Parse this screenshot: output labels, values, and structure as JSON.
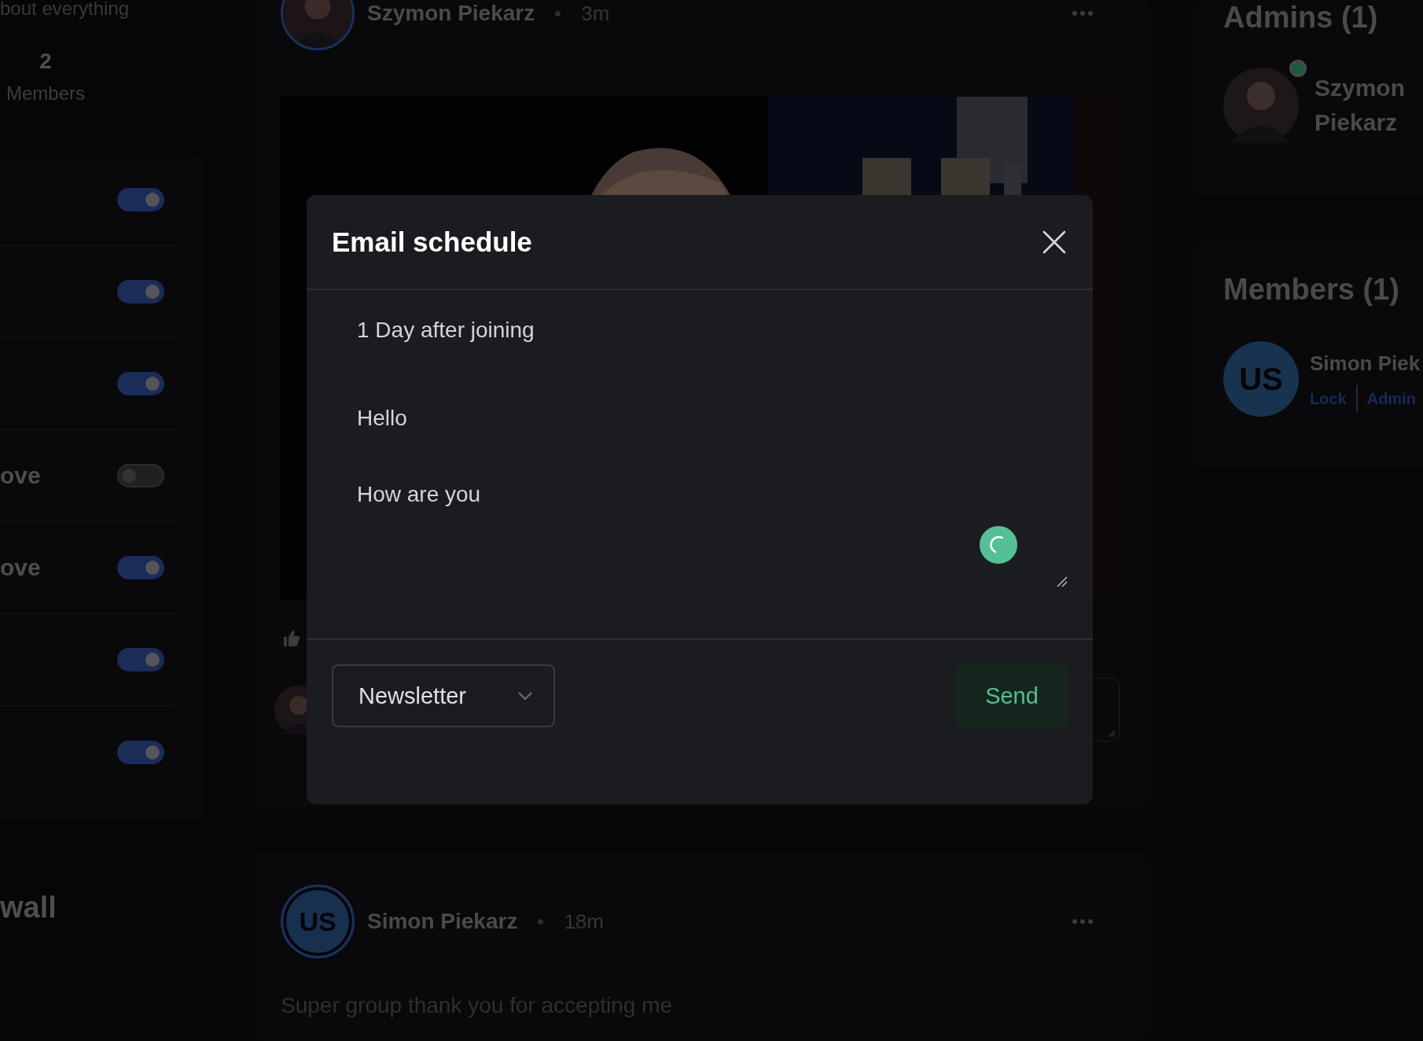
{
  "group": {
    "description": "bout everything",
    "members_count": "2",
    "members_label": "Members"
  },
  "settings": [
    {
      "on": true
    },
    {
      "on": true
    },
    {
      "on": true
    },
    {
      "label": "ove",
      "on": false
    },
    {
      "label": "ove",
      "on": true
    },
    {
      "on": true
    },
    {
      "on": true
    }
  ],
  "wall_title": "wall",
  "posts": [
    {
      "author": "Szymon Piekarz",
      "time": "3m",
      "comment_field": {
        "kind": "empty"
      }
    },
    {
      "author": "Simon Piekarz",
      "time": "18m",
      "avatar": {
        "kind": "initials",
        "initials": "US"
      },
      "text": "Super group thank you for accepting me"
    }
  ],
  "admins": {
    "title": "Admins (1)",
    "people": [
      {
        "name": "Szymon Piekarz",
        "online": true
      }
    ]
  },
  "members": {
    "title": "Members (1)",
    "people": [
      {
        "name": "Simon Piek",
        "avatar": {
          "kind": "initials",
          "initials": "US"
        },
        "actions": [
          "Lock",
          "Admin"
        ]
      }
    ]
  },
  "modal": {
    "title": "Email schedule",
    "message_lines": [
      "1 Day after joining",
      "Hello",
      "How are you"
    ],
    "loading": true,
    "template": {
      "value": "Newsletter"
    },
    "send_label": "Send"
  }
}
